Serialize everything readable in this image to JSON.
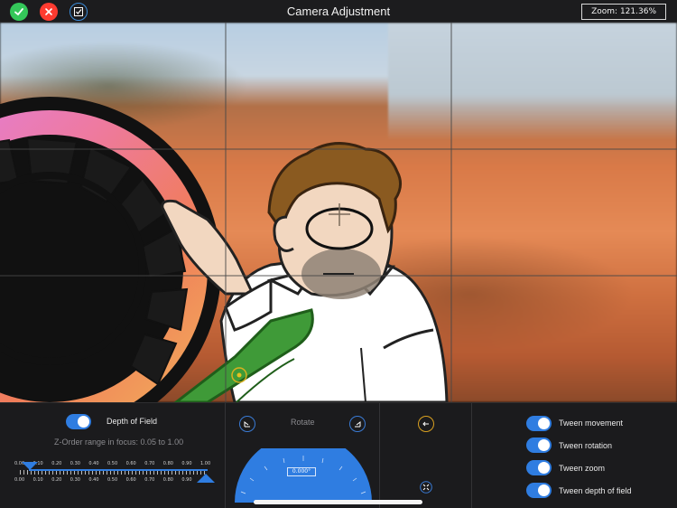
{
  "header": {
    "title": "Camera Adjustment",
    "zoom_label": "Zoom: 121.36%"
  },
  "depth_of_field": {
    "label": "Depth of Field",
    "enabled": true,
    "range_text": "Z-Order range in focus: 0.05 to 1.00",
    "ticks_top": [
      "0.00",
      "0.10",
      "0.20",
      "0.30",
      "0.40",
      "0.50",
      "0.60",
      "0.70",
      "0.80",
      "0.90",
      "1.00"
    ],
    "ticks_bottom": [
      "0.00",
      "0.10",
      "0.20",
      "0.30",
      "0.40",
      "0.50",
      "0.60",
      "0.70",
      "0.80",
      "0.90"
    ],
    "range_low": 0.05,
    "range_high": 1.0
  },
  "rotate": {
    "label": "Rotate",
    "value": "0.000°"
  },
  "tweens": [
    {
      "label": "Tween movement",
      "enabled": true
    },
    {
      "label": "Tween rotation",
      "enabled": true
    },
    {
      "label": "Tween zoom",
      "enabled": true
    },
    {
      "label": "Tween depth of field",
      "enabled": true
    }
  ],
  "colors": {
    "accent": "#2f7de1",
    "ok": "#34c759",
    "cancel": "#ff3b30"
  },
  "icons": [
    "checkmark-icon",
    "close-icon",
    "checkbox-icon",
    "rotate-left-icon",
    "rotate-right-icon",
    "reset-icon",
    "fit-icon"
  ]
}
